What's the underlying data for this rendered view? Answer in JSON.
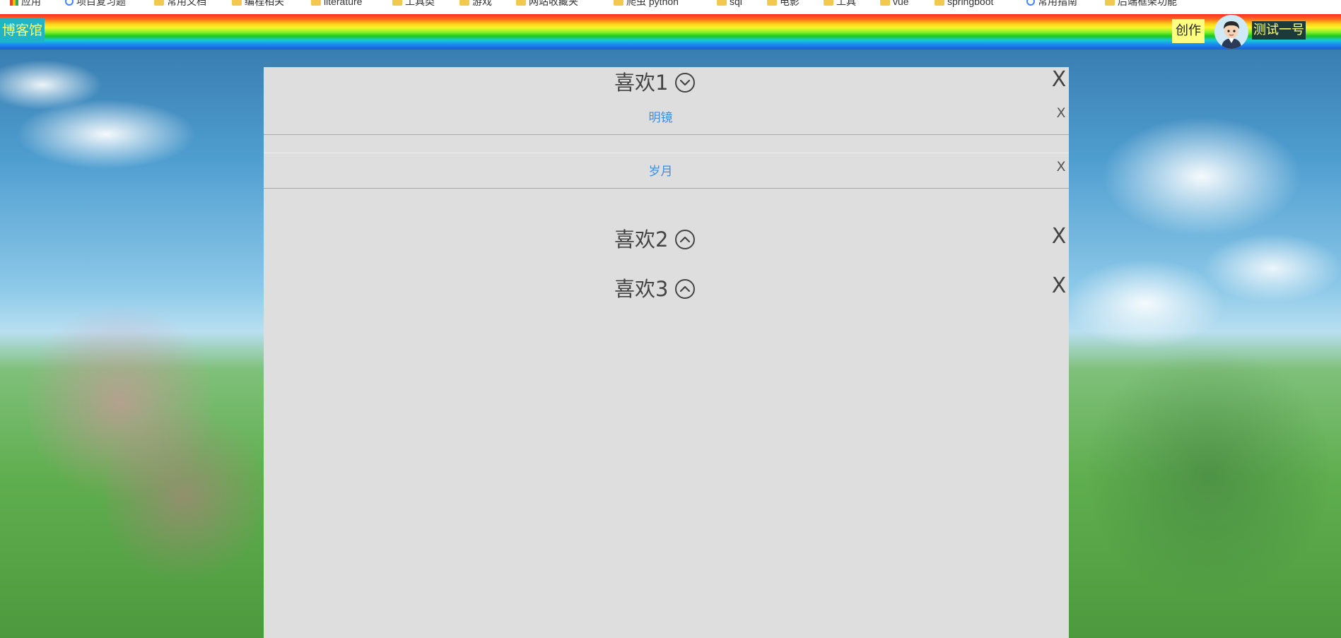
{
  "bookmarks": [
    {
      "label": "应用",
      "icon": "apps-icon"
    },
    {
      "label": "项目复习题",
      "icon": "google-icon"
    },
    {
      "label": "常用文档",
      "icon": "folder-icon"
    },
    {
      "label": "编程相关",
      "icon": "folder-icon"
    },
    {
      "label": "literature",
      "icon": "folder-icon"
    },
    {
      "label": "工具类",
      "icon": "folder-icon"
    },
    {
      "label": "游戏",
      "icon": "folder-icon"
    },
    {
      "label": "网站收藏夹",
      "icon": "folder-icon"
    },
    {
      "label": "爬虫 python",
      "icon": "folder-icon"
    },
    {
      "label": "sql",
      "icon": "folder-icon"
    },
    {
      "label": "电影",
      "icon": "folder-icon"
    },
    {
      "label": "工具",
      "icon": "folder-icon"
    },
    {
      "label": "vue",
      "icon": "folder-icon"
    },
    {
      "label": "springboot",
      "icon": "folder-icon"
    },
    {
      "label": "常用指南",
      "icon": "google-icon"
    },
    {
      "label": "后端框架功能",
      "icon": "folder-icon"
    }
  ],
  "navbar": {
    "logo": "博客馆",
    "create_label": "创作",
    "username": "测试一号",
    "avatar_icon": "user-avatar"
  },
  "groups": [
    {
      "title": "喜欢1",
      "expanded": true,
      "chevron": "chevron-down-circle-icon",
      "close": "X",
      "items": [
        {
          "label": "明镜",
          "close": "X"
        },
        {
          "label": "岁月",
          "close": "X"
        }
      ]
    },
    {
      "title": "喜欢2",
      "expanded": false,
      "chevron": "chevron-up-circle-icon",
      "close": "X",
      "items": []
    },
    {
      "title": "喜欢3",
      "expanded": false,
      "chevron": "chevron-up-circle-icon",
      "close": "X",
      "items": []
    }
  ],
  "colors": {
    "panel_bg": "#dedede",
    "link": "#3b8de0",
    "logo_bg": "#1fb5c8",
    "logo_text": "#ffff66",
    "create_bg": "#ffff80",
    "username_bg": "#1c3a3a"
  }
}
